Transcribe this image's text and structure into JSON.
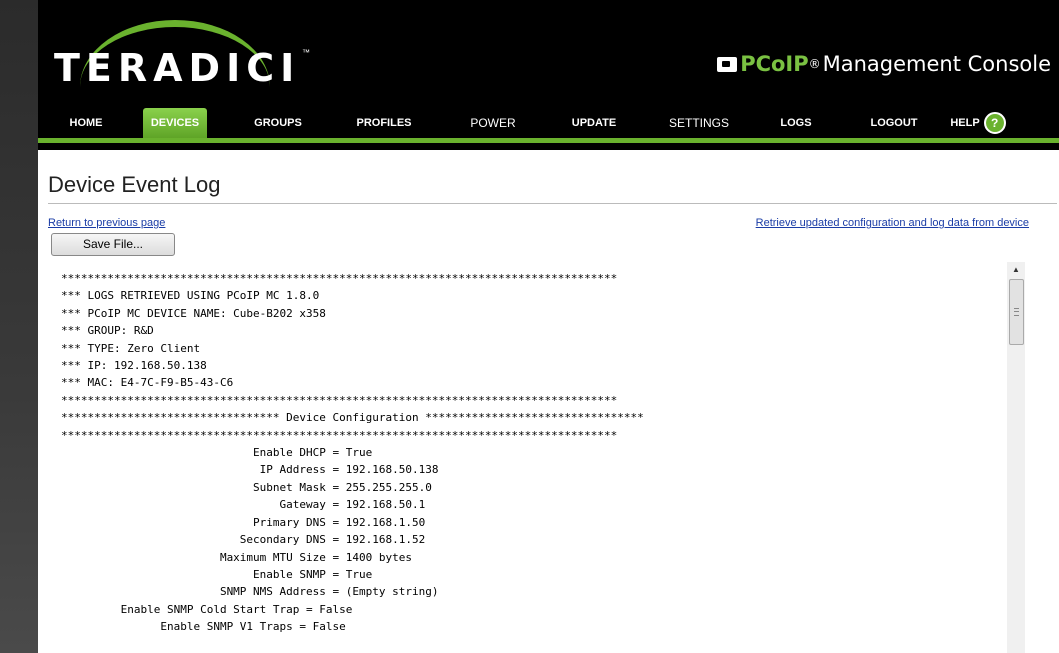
{
  "brand": {
    "logo_text": "TERADICI",
    "logo_tm": "™",
    "title_prefix": "PCoIP",
    "title_reg": "®",
    "title_suffix": "Management Console"
  },
  "nav": {
    "items": [
      {
        "label": "HOME"
      },
      {
        "label": "DEVICES"
      },
      {
        "label": "GROUPS"
      },
      {
        "label": "PROFILES"
      },
      {
        "label": "POWER"
      },
      {
        "label": "UPDATE"
      },
      {
        "label": "SETTINGS"
      },
      {
        "label": "LOGS"
      },
      {
        "label": "LOGOUT"
      },
      {
        "label": "HELP"
      }
    ],
    "active": "DEVICES",
    "help_icon_glyph": "?",
    "accent_color": "#6ab22e"
  },
  "page": {
    "title": "Device Event Log",
    "return_link": "Return to previous page",
    "retrieve_link": "Retrieve updated configuration and log data from device",
    "save_button": "Save File..."
  },
  "log": {
    "lines": [
      "************************************************************************************",
      "*** LOGS RETRIEVED USING PCoIP MC 1.8.0",
      "*** PCoIP MC DEVICE NAME: Cube-B202 x358",
      "*** GROUP: R&D",
      "*** TYPE: Zero Client",
      "*** IP: 192.168.50.138",
      "*** MAC: E4-7C-F9-B5-43-C6",
      "************************************************************************************",
      "********************************* Device Configuration *********************************",
      "************************************************************************************",
      "                             Enable DHCP = True",
      "                              IP Address = 192.168.50.138",
      "                             Subnet Mask = 255.255.255.0",
      "                                 Gateway = 192.168.50.1",
      "                             Primary DNS = 192.168.1.50",
      "                           Secondary DNS = 192.168.1.52",
      "                        Maximum MTU Size = 1400 bytes",
      "                             Enable SNMP = True",
      "                        SNMP NMS Address = (Empty string)",
      "         Enable SNMP Cold Start Trap = False",
      "               Enable SNMP V1 Traps = False"
    ]
  },
  "scrollbar": {
    "up_glyph": "▲"
  }
}
